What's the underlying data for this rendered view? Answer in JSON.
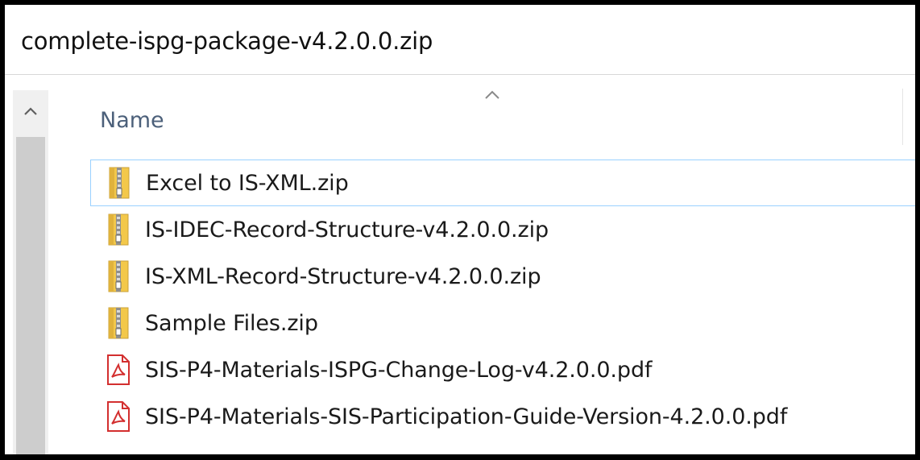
{
  "window": {
    "title": "complete-ispg-package-v4.2.0.0.zip"
  },
  "header": {
    "name_column": "Name"
  },
  "files": [
    {
      "name": "Excel to IS-XML.zip",
      "icon": "zip-folder-icon",
      "selected": true
    },
    {
      "name": "IS-IDEC-Record-Structure-v4.2.0.0.zip",
      "icon": "zip-folder-icon",
      "selected": false
    },
    {
      "name": "IS-XML-Record-Structure-v4.2.0.0.zip",
      "icon": "zip-folder-icon",
      "selected": false
    },
    {
      "name": "Sample Files.zip",
      "icon": "zip-folder-icon",
      "selected": false
    },
    {
      "name": "SIS-P4-Materials-ISPG-Change-Log-v4.2.0.0.pdf",
      "icon": "pdf-icon",
      "selected": false
    },
    {
      "name": "SIS-P4-Materials-SIS-Participation-Guide-Version-4.2.0.0.pdf",
      "icon": "pdf-icon",
      "selected": false
    }
  ],
  "colors": {
    "selection_border": "#99d1ff",
    "header_text": "#4c607a",
    "pdf_red": "#d32f2f",
    "zip_folder": "#f3c84a"
  }
}
